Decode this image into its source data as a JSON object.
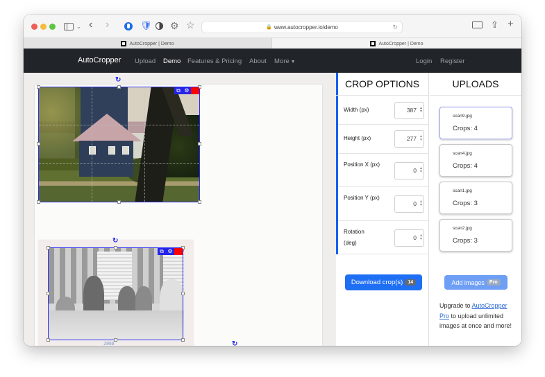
{
  "browser": {
    "url": "www.autocropper.io/demo",
    "tabs": [
      {
        "label": "AutoCropper | Demo",
        "active": true
      },
      {
        "label": "AutoCropper | Demo",
        "active": false
      }
    ]
  },
  "navbar": {
    "brand": "AutoCropper",
    "links": [
      {
        "label": "Upload",
        "active": false
      },
      {
        "label": "Demo",
        "active": true
      },
      {
        "label": "Features & Pricing",
        "active": false
      },
      {
        "label": "About",
        "active": false
      },
      {
        "label": "More",
        "active": false,
        "dropdown": true
      }
    ],
    "right_links": [
      {
        "label": "Login"
      },
      {
        "label": "Register"
      }
    ]
  },
  "canvas": {
    "crops": [
      {
        "subject": "house photo",
        "selected": true
      },
      {
        "subject": "family dinner photo",
        "selected": false
      }
    ],
    "caption": "1956"
  },
  "crop_options": {
    "title": "CROP OPTIONS",
    "fields": [
      {
        "label": "Width (px)",
        "value": "387"
      },
      {
        "label": "Height (px)",
        "value": "277"
      },
      {
        "label": "Position X (px)",
        "value": "0"
      },
      {
        "label": "Position Y (px)",
        "value": "0"
      },
      {
        "label": "Rotation (deg)",
        "value": "0"
      }
    ],
    "download_label": "Download crop(s)",
    "download_count": "14"
  },
  "uploads": {
    "title": "UPLOADS",
    "items": [
      {
        "name": "scan9.jpg",
        "crops": "Crops: 4",
        "selected": true
      },
      {
        "name": "scan4.jpg",
        "crops": "Crops: 4",
        "selected": false
      },
      {
        "name": "scan1.jpg",
        "crops": "Crops: 3",
        "selected": false
      },
      {
        "name": "scan2.jpg",
        "crops": "Crops: 3",
        "selected": false
      }
    ],
    "add_images_label": "Add images",
    "add_images_badge": "Pro",
    "upgrade_prefix": "Upgrade to ",
    "upgrade_link": "AutoCropper Pro",
    "upgrade_suffix": " to upload unlimited images at once and more!"
  },
  "colors": {
    "accent": "#1f6ff5",
    "crop_border": "#2a2ef0",
    "navbar_bg": "#212428",
    "delete": "#ff0000"
  }
}
